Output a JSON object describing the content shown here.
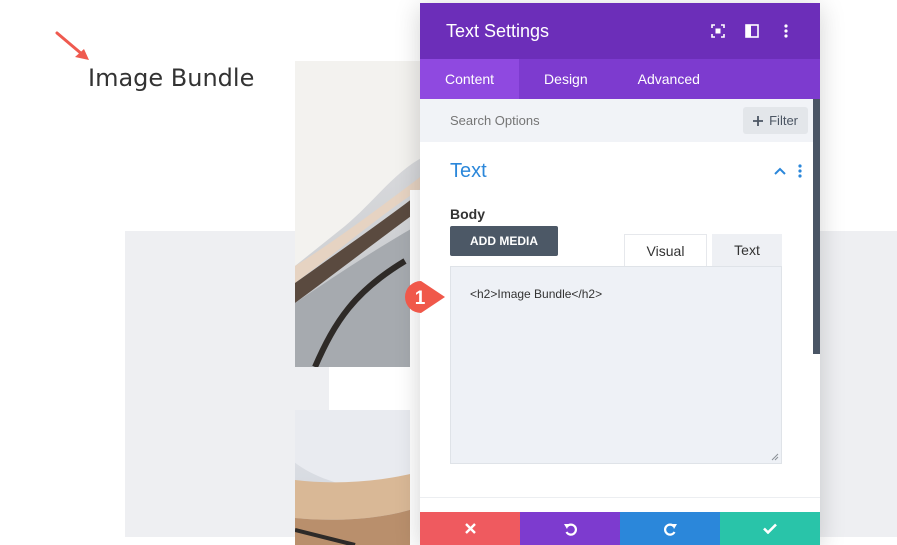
{
  "page": {
    "heading": "Image Bundle"
  },
  "modal": {
    "title": "Text Settings",
    "tabs": [
      "Content",
      "Design",
      "Advanced"
    ],
    "active_tab": "Content",
    "search": {
      "placeholder": "Search Options"
    },
    "filter_label": "Filter",
    "section_title": "Text",
    "field_label": "Body",
    "add_media_label": "ADD MEDIA",
    "editor_tabs": [
      "Visual",
      "Text"
    ],
    "editor_content": "<h2>Image Bundle</h2>",
    "footer_buttons": [
      "close",
      "undo",
      "redo",
      "save"
    ]
  },
  "annotation": {
    "badge": "1"
  },
  "colors": {
    "header_purple": "#6c2eb9",
    "tabs_purple": "#7d3bcf",
    "active_tab": "#8f49e0",
    "section_blue": "#2b87da",
    "close_red": "#ef5a5f",
    "undo_purple": "#7d3bcf",
    "redo_blue": "#2b87da",
    "save_green": "#29c4a9",
    "badge_orange": "#f0584a",
    "arrow_red": "#ef5a4f"
  },
  "icons": {
    "header": [
      "fullscreen-icon",
      "split-view-icon",
      "more-vertical-icon"
    ],
    "footer": [
      "x-icon",
      "undo-icon",
      "redo-icon",
      "check-icon"
    ]
  }
}
